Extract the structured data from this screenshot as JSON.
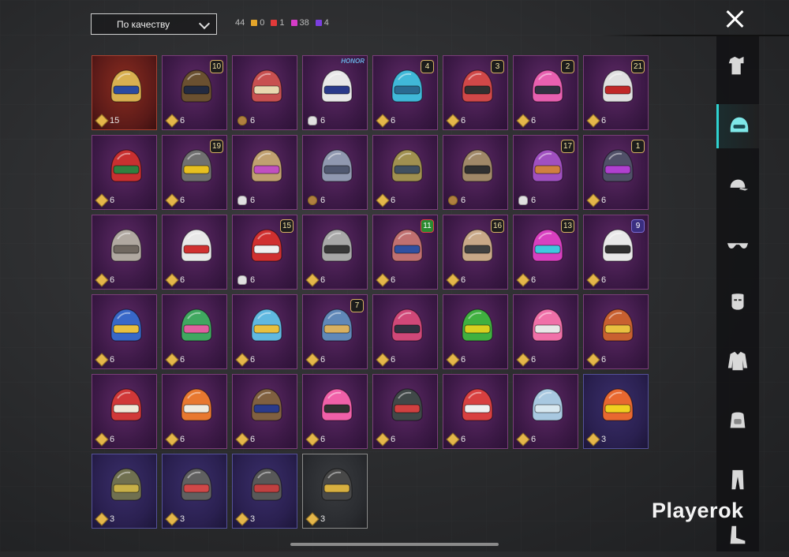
{
  "header": {
    "sort_label": "По качеству",
    "total": "44",
    "counts": [
      {
        "color": "#e4a52a",
        "value": "0"
      },
      {
        "color": "#e23a3a",
        "value": "1"
      },
      {
        "color": "#d63cc8",
        "value": "38"
      },
      {
        "color": "#7a3fe0",
        "value": "4"
      }
    ]
  },
  "sidebar": {
    "categories": [
      "outfit-icon",
      "helmet-icon",
      "cap-icon",
      "glasses-icon",
      "mask-icon",
      "jacket-icon",
      "backpack-icon",
      "pants-icon",
      "shoes-icon"
    ],
    "active": "helmet-icon"
  },
  "items": [
    {
      "qty": "15",
      "cur": "gem",
      "lvl": "",
      "tier": "red",
      "c": "#d8b050",
      "c2": "#2a4aa0"
    },
    {
      "qty": "6",
      "cur": "gem",
      "lvl": "10",
      "tier": "",
      "c": "#6a5030",
      "c2": "#222a40"
    },
    {
      "qty": "6",
      "cur": "coin",
      "lvl": "",
      "tier": "",
      "c": "#c85050",
      "c2": "#e8d8b0"
    },
    {
      "qty": "6",
      "cur": "cloud",
      "lvl": "",
      "tier": "",
      "c": "#e8e8e8",
      "c2": "#2a3a8a",
      "honor": "HONOR"
    },
    {
      "qty": "6",
      "cur": "gem",
      "lvl": "4",
      "tier": "",
      "c": "#40b8d8",
      "c2": "#2a6a90"
    },
    {
      "qty": "6",
      "cur": "gem",
      "lvl": "3",
      "tier": "",
      "c": "#d04848",
      "c2": "#303030"
    },
    {
      "qty": "6",
      "cur": "gem",
      "lvl": "2",
      "tier": "",
      "c": "#e860b0",
      "c2": "#303040"
    },
    {
      "qty": "6",
      "cur": "gem",
      "lvl": "21",
      "tier": "",
      "c": "#e0e0e0",
      "c2": "#c02828"
    },
    {
      "qty": "6",
      "cur": "gem",
      "lvl": "",
      "tier": "",
      "c": "#c83030",
      "c2": "#308040"
    },
    {
      "qty": "6",
      "cur": "gem",
      "lvl": "19",
      "tier": "",
      "c": "#707070",
      "c2": "#e8c020"
    },
    {
      "qty": "6",
      "cur": "cloud",
      "lvl": "",
      "tier": "",
      "c": "#c0a070",
      "c2": "#c050c0"
    },
    {
      "qty": "6",
      "cur": "coin",
      "lvl": "",
      "tier": "",
      "c": "#9098b0",
      "c2": "#505870"
    },
    {
      "qty": "6",
      "cur": "gem",
      "lvl": "",
      "tier": "",
      "c": "#a09050",
      "c2": "#405060"
    },
    {
      "qty": "6",
      "cur": "coin",
      "lvl": "",
      "tier": "",
      "c": "#a08868",
      "c2": "#303030"
    },
    {
      "qty": "6",
      "cur": "cloud",
      "lvl": "17",
      "tier": "",
      "c": "#a050c0",
      "c2": "#d08040"
    },
    {
      "qty": "6",
      "cur": "gem",
      "lvl": "1",
      "tier": "",
      "c": "#505068",
      "c2": "#b040d0"
    },
    {
      "qty": "6",
      "cur": "gem",
      "lvl": "",
      "tier": "",
      "c": "#b0a8a0",
      "c2": "#706860"
    },
    {
      "qty": "6",
      "cur": "gem",
      "lvl": "",
      "tier": "",
      "c": "#e8e8e8",
      "c2": "#d03030"
    },
    {
      "qty": "6",
      "cur": "cloud",
      "lvl": "15",
      "tier": "",
      "c": "#d03030",
      "c2": "#f0f0f0"
    },
    {
      "qty": "6",
      "cur": "gem",
      "lvl": "",
      "tier": "",
      "c": "#a8a8a8",
      "c2": "#383838"
    },
    {
      "qty": "6",
      "cur": "gem",
      "lvl": "11",
      "tier": "",
      "lvlstyle": "red",
      "c": "#c07070",
      "c2": "#3050a0"
    },
    {
      "qty": "6",
      "cur": "gem",
      "lvl": "16",
      "tier": "",
      "c": "#c8a888",
      "c2": "#404040"
    },
    {
      "qty": "6",
      "cur": "gem",
      "lvl": "13",
      "tier": "",
      "c": "#d840c0",
      "c2": "#40c8e0"
    },
    {
      "qty": "6",
      "cur": "gem",
      "lvl": "9",
      "tier": "",
      "lvlstyle": "purple",
      "c": "#e8e8e8",
      "c2": "#303030"
    },
    {
      "qty": "6",
      "cur": "gem",
      "lvl": "",
      "tier": "",
      "c": "#3868c8",
      "c2": "#e8c040"
    },
    {
      "qty": "6",
      "cur": "gem",
      "lvl": "",
      "tier": "",
      "c": "#40a860",
      "c2": "#e060a0"
    },
    {
      "qty": "6",
      "cur": "gem",
      "lvl": "",
      "tier": "",
      "c": "#60b8e0",
      "c2": "#e8c040"
    },
    {
      "qty": "6",
      "cur": "gem",
      "lvl": "7",
      "tier": "",
      "c": "#6088b8",
      "c2": "#d8b060"
    },
    {
      "qty": "6",
      "cur": "gem",
      "lvl": "",
      "tier": "",
      "c": "#d04878",
      "c2": "#303040"
    },
    {
      "qty": "6",
      "cur": "gem",
      "lvl": "",
      "tier": "",
      "c": "#40b040",
      "c2": "#d8d020"
    },
    {
      "qty": "6",
      "cur": "gem",
      "lvl": "",
      "tier": "",
      "c": "#f070a8",
      "c2": "#e8e8e8"
    },
    {
      "qty": "6",
      "cur": "gem",
      "lvl": "",
      "tier": "",
      "c": "#c86030",
      "c2": "#e8c040"
    },
    {
      "qty": "6",
      "cur": "gem",
      "lvl": "",
      "tier": "",
      "c": "#d03838",
      "c2": "#f0e8d8"
    },
    {
      "qty": "6",
      "cur": "gem",
      "lvl": "",
      "tier": "",
      "c": "#e87830",
      "c2": "#f0ece0"
    },
    {
      "qty": "6",
      "cur": "gem",
      "lvl": "",
      "tier": "",
      "c": "#806040",
      "c2": "#2a3a8a"
    },
    {
      "qty": "6",
      "cur": "gem",
      "lvl": "",
      "tier": "",
      "c": "#f060a8",
      "c2": "#303030"
    },
    {
      "qty": "6",
      "cur": "gem",
      "lvl": "",
      "tier": "",
      "c": "#404848",
      "c2": "#d04040"
    },
    {
      "qty": "6",
      "cur": "gem",
      "lvl": "",
      "tier": "",
      "c": "#d84040",
      "c2": "#f0f0f0"
    },
    {
      "qty": "6",
      "cur": "gem",
      "lvl": "",
      "tier": "",
      "c": "#a8c8e0",
      "c2": "#d8e8f0"
    },
    {
      "qty": "3",
      "cur": "gem",
      "lvl": "",
      "tier": "blue",
      "c": "#e86830",
      "c2": "#f0d020"
    },
    {
      "qty": "3",
      "cur": "gem",
      "lvl": "",
      "tier": "blue",
      "c": "#707050",
      "c2": "#c8b048"
    },
    {
      "qty": "3",
      "cur": "gem",
      "lvl": "",
      "tier": "blue",
      "c": "#606060",
      "c2": "#d04848"
    },
    {
      "qty": "3",
      "cur": "gem",
      "lvl": "",
      "tier": "blue",
      "c": "#585858",
      "c2": "#c04040"
    },
    {
      "qty": "3",
      "cur": "gem",
      "lvl": "",
      "tier": "dark",
      "c": "#484848",
      "c2": "#d8b040"
    }
  ],
  "watermark": "Playerok"
}
